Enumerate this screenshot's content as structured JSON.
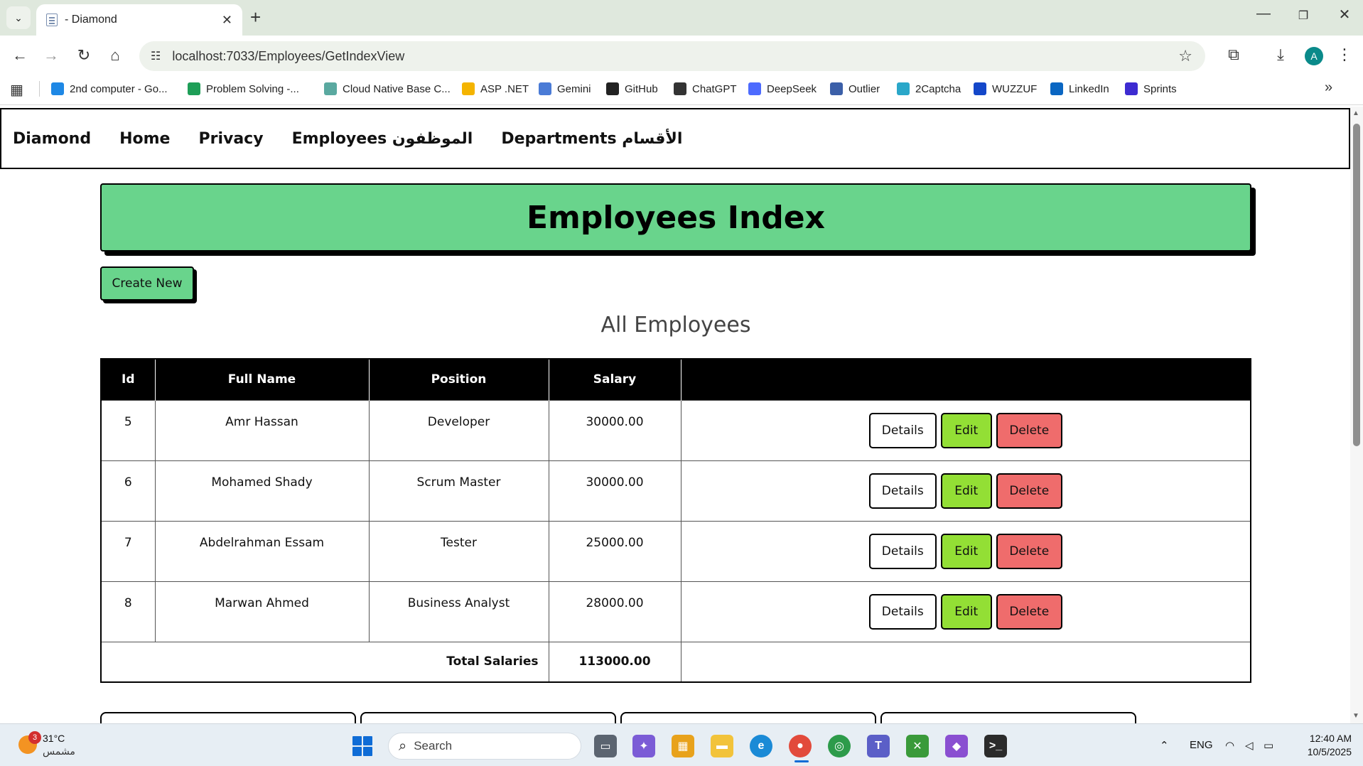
{
  "browser": {
    "tab_title": "- Diamond",
    "url": "localhost:7033/Employees/GetIndexView",
    "profile_initial": "A",
    "bookmarks": [
      {
        "label": "2nd computer - Go...",
        "icon": "google-drive-icon",
        "color": "#1e88e5"
      },
      {
        "label": "Problem Solving -...",
        "icon": "sheets-icon",
        "color": "#1e9e57"
      },
      {
        "label": "Cloud Native Base C...",
        "icon": "cloud-icon",
        "color": "#5aa9a0"
      },
      {
        "label": "ASP .NET",
        "icon": "google-drive-icon",
        "color": "#f4b400"
      },
      {
        "label": "Gemini",
        "icon": "gemini-icon",
        "color": "#4a7bd6"
      },
      {
        "label": "GitHub",
        "icon": "github-icon",
        "color": "#222222"
      },
      {
        "label": "ChatGPT",
        "icon": "chatgpt-icon",
        "color": "#333333"
      },
      {
        "label": "DeepSeek",
        "icon": "deepseek-icon",
        "color": "#4d6bfe"
      },
      {
        "label": "Outlier",
        "icon": "outlier-icon",
        "color": "#3b5fa8"
      },
      {
        "label": "2Captcha",
        "icon": "2captcha-icon",
        "color": "#2aa7c9"
      },
      {
        "label": "WUZZUF",
        "icon": "wuzzuf-icon",
        "color": "#1447c9"
      },
      {
        "label": "LinkedIn",
        "icon": "linkedin-icon",
        "color": "#0a66c2"
      },
      {
        "label": "Sprints",
        "icon": "sprints-icon",
        "color": "#3d2bd1"
      }
    ]
  },
  "site": {
    "nav": {
      "brand": "Diamond",
      "home": "Home",
      "privacy": "Privacy",
      "employees": "Employees الموظفون",
      "departments": "Departments الأقسام"
    },
    "header_title": "Employees Index",
    "create_label": "Create New",
    "section_title": "All Employees",
    "table": {
      "headers": [
        "Id",
        "Full Name",
        "Position",
        "Salary",
        ""
      ],
      "rows": [
        {
          "id": "5",
          "name": "Amr Hassan",
          "position": "Developer",
          "salary": "30000.00"
        },
        {
          "id": "6",
          "name": "Mohamed Shady",
          "position": "Scrum Master",
          "salary": "30000.00"
        },
        {
          "id": "7",
          "name": "Abdelrahman Essam",
          "position": "Tester",
          "salary": "25000.00"
        },
        {
          "id": "8",
          "name": "Marwan Ahmed",
          "position": "Business Analyst",
          "salary": "28000.00"
        }
      ],
      "actions": {
        "details": "Details",
        "edit": "Edit",
        "delete": "Delete"
      },
      "total_label": "Total Salaries",
      "total_value": "113000.00"
    }
  },
  "taskbar": {
    "weather_temp": "31°C",
    "weather_cond": "مشمس",
    "weather_badge": "3",
    "search_placeholder": "Search",
    "language": "ENG",
    "time": "12:40 AM",
    "date": "10/5/2025"
  },
  "colors": {
    "header_green": "#69d48c",
    "edit_green": "#93df35",
    "delete_red": "#ef6c6c"
  }
}
